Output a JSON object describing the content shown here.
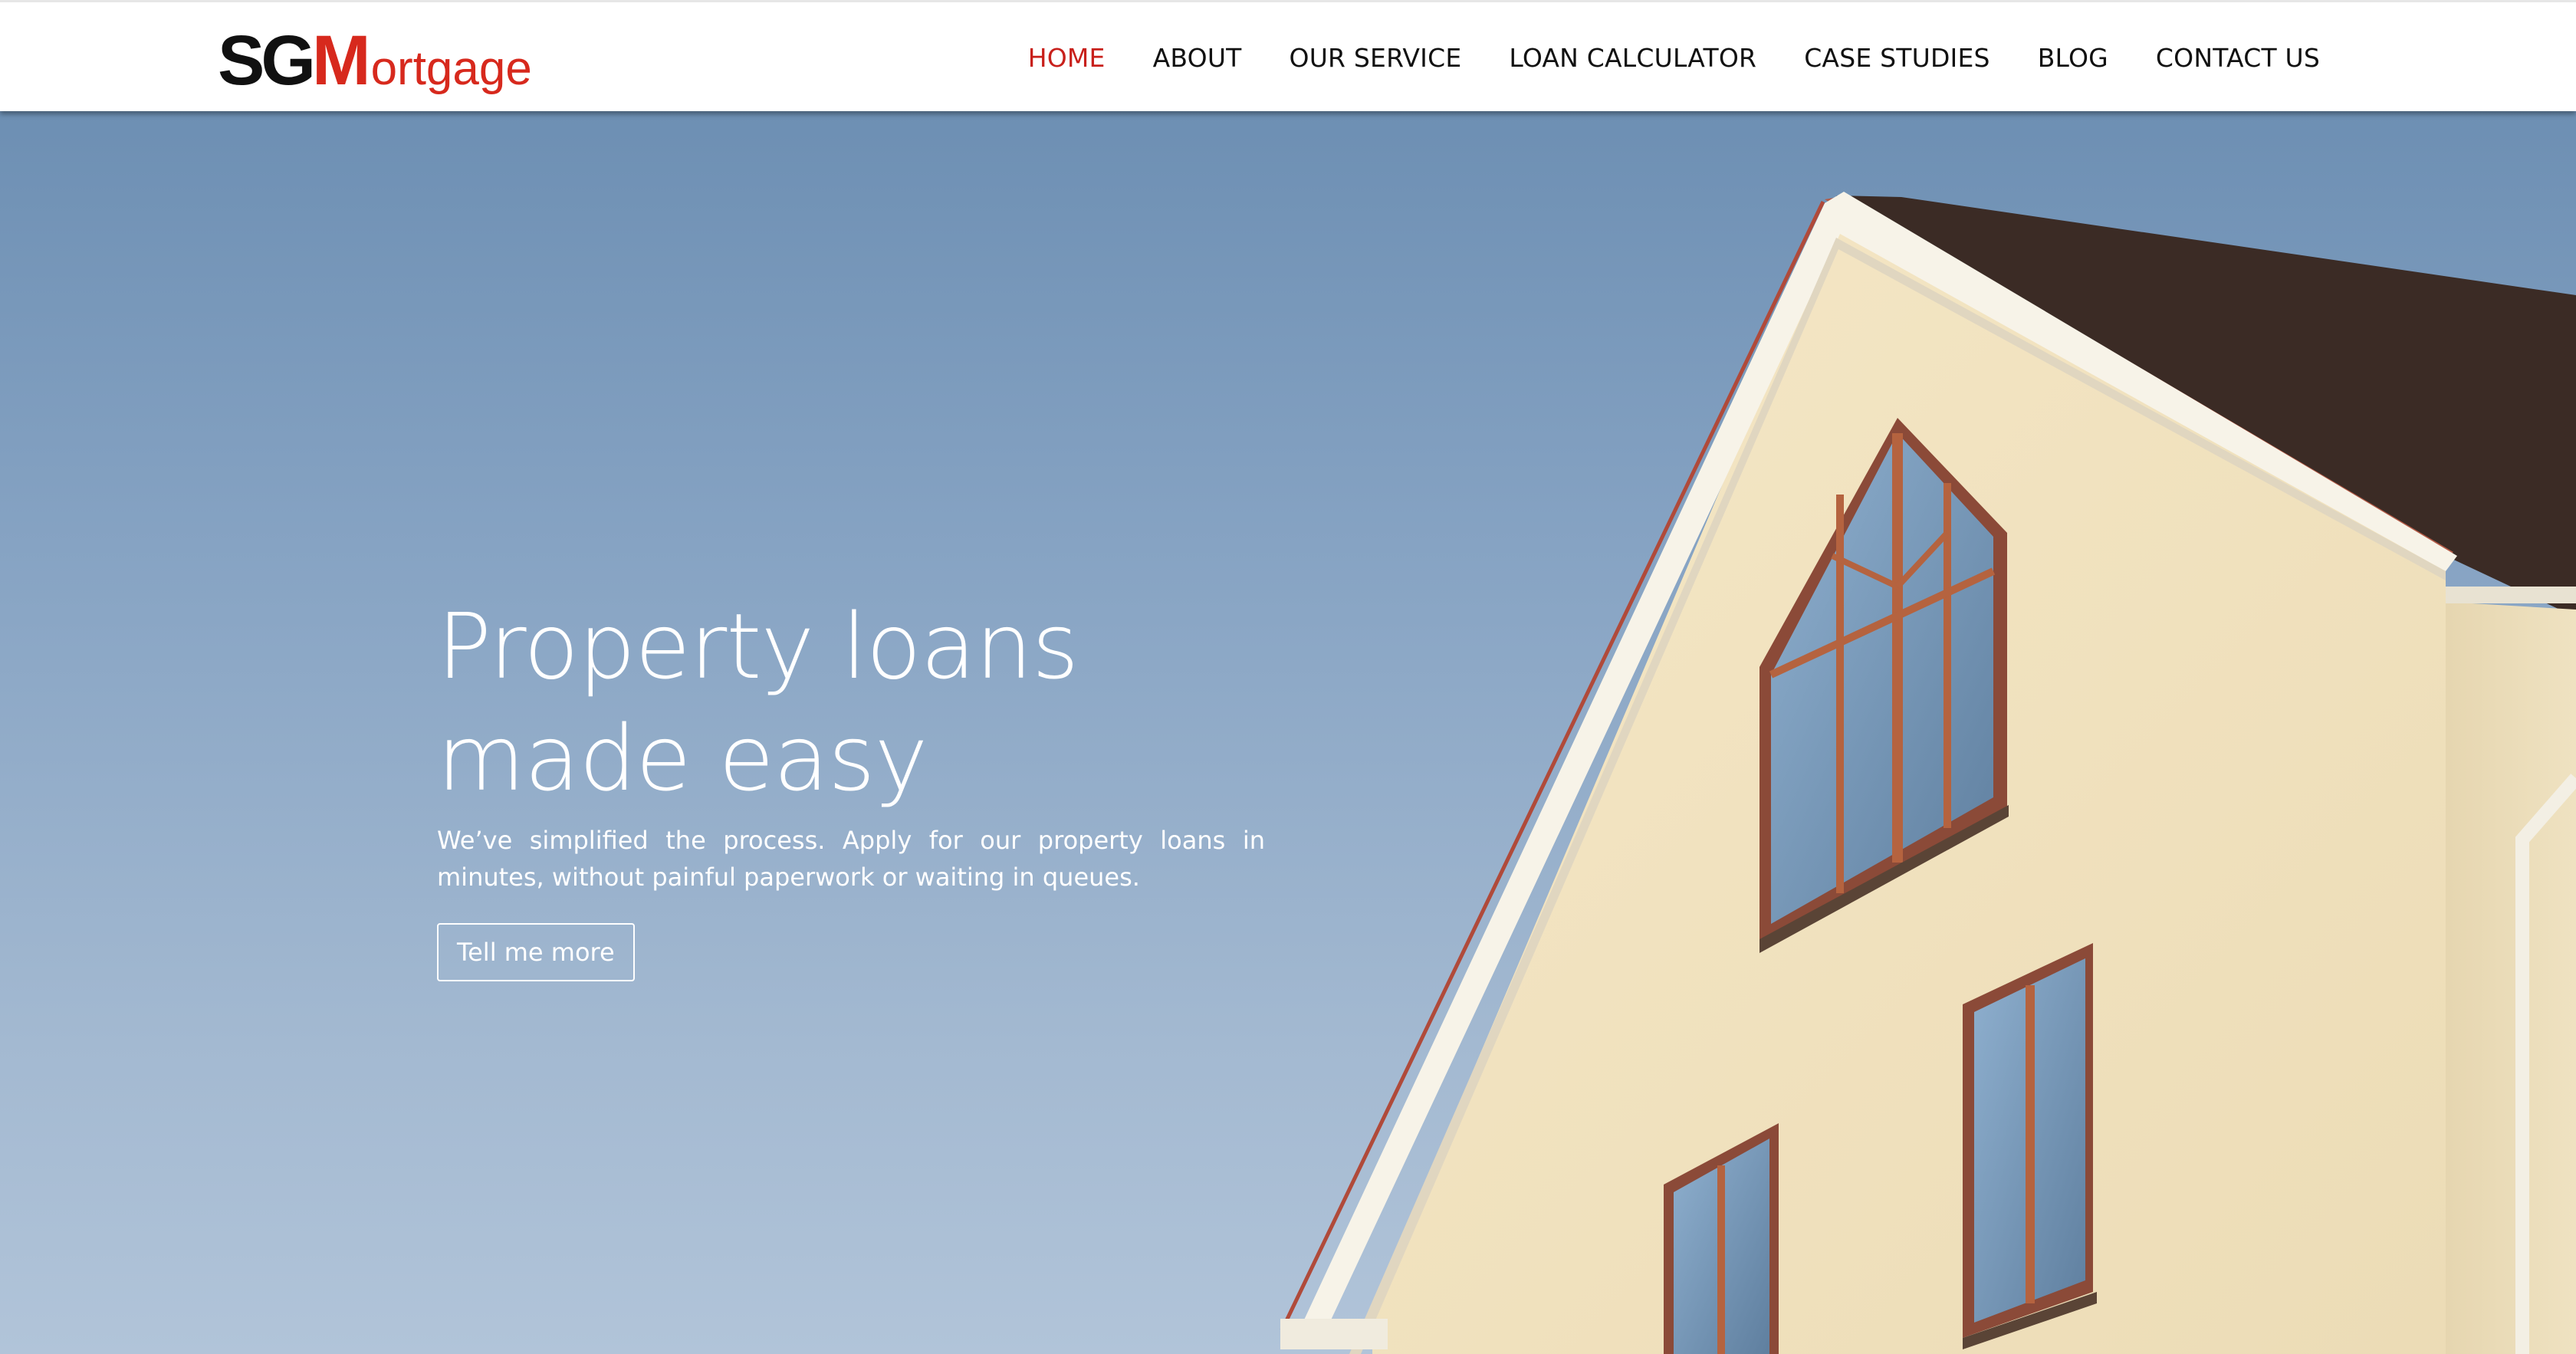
{
  "brand": {
    "logo_part1": "SG",
    "logo_part2": "M",
    "logo_part3": "ortgage",
    "accent_color": "#d7291d"
  },
  "nav": {
    "items": [
      {
        "label": "HOME",
        "active": true
      },
      {
        "label": "ABOUT"
      },
      {
        "label": "OUR SERVICE"
      },
      {
        "label": "LOAN CALCULATOR"
      },
      {
        "label": "CASE STUDIES"
      },
      {
        "label": "BLOG"
      },
      {
        "label": "CONTACT US"
      }
    ]
  },
  "hero": {
    "title": "Property loans made easy",
    "subtitle": "We’ve simplified the process. Apply for our property loans in minutes, without painful paperwork or waiting in queues.",
    "cta_label": "Tell me more"
  }
}
